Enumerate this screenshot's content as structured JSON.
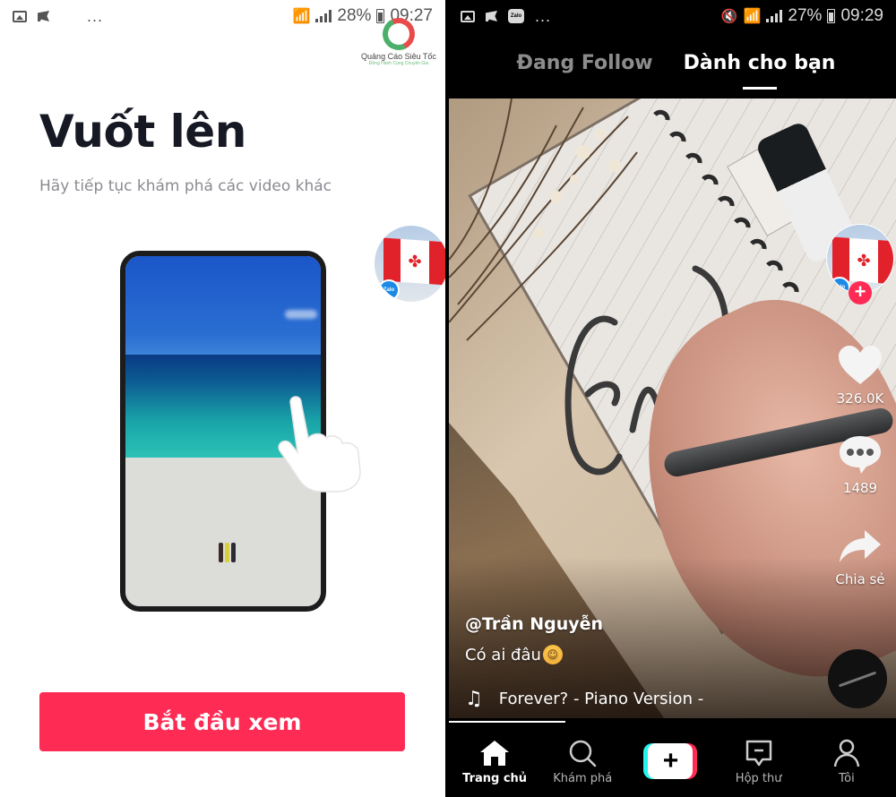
{
  "left_screen": {
    "status_bar": {
      "icons_left": [
        "image-icon",
        "flag-icon",
        "zalo-icon"
      ],
      "overflow": "...",
      "battery": "28%",
      "time": "09:27"
    },
    "watermark": {
      "title": "Quảng Cáo Siêu Tốc",
      "subtitle": "Đồng Hành Cùng Chuyên Gia"
    },
    "title": "Vuốt lên",
    "subtitle": "Hãy tiếp tục khám phá các video khác",
    "illustration": "phone-swipe-up-beach",
    "cta_button": "Bắt đầu xem",
    "floating_bubble": {
      "badge": "Zalo"
    },
    "colors": {
      "accent": "#fe2c55",
      "title": "#161823",
      "subtitle": "#8a8b91"
    }
  },
  "right_screen": {
    "status_bar": {
      "icons_left": [
        "image-icon",
        "flag-icon",
        "zalo-icon"
      ],
      "overflow": "...",
      "battery": "27%",
      "time": "09:29"
    },
    "tabs": [
      {
        "label": "Đang Follow",
        "active": false
      },
      {
        "label": "Dành cho bạn",
        "active": true
      }
    ],
    "creator": {
      "avatar_badge": "Zalo",
      "follow_icon": "+"
    },
    "actions": {
      "likes": "326.0K",
      "comments": "1489",
      "share": "Chia sẻ"
    },
    "video": {
      "username": "@Trần Nguyễn",
      "caption": "Có ai đâu",
      "caption_emoji": "☺",
      "music": "Forever? - Piano Version -"
    },
    "bottom_nav": [
      {
        "label": "Trang chủ",
        "icon": "home-icon",
        "active": true
      },
      {
        "label": "Khám phá",
        "icon": "search-icon",
        "active": false
      },
      {
        "label": "",
        "icon": "create-plus-icon",
        "active": false
      },
      {
        "label": "Hộp thư",
        "icon": "inbox-icon",
        "active": false
      },
      {
        "label": "Tôi",
        "icon": "profile-icon",
        "active": false
      }
    ],
    "create_symbol": "+",
    "colors": {
      "accent": "#fe2c55",
      "cyan": "#25f4ee",
      "background": "#000000"
    }
  }
}
